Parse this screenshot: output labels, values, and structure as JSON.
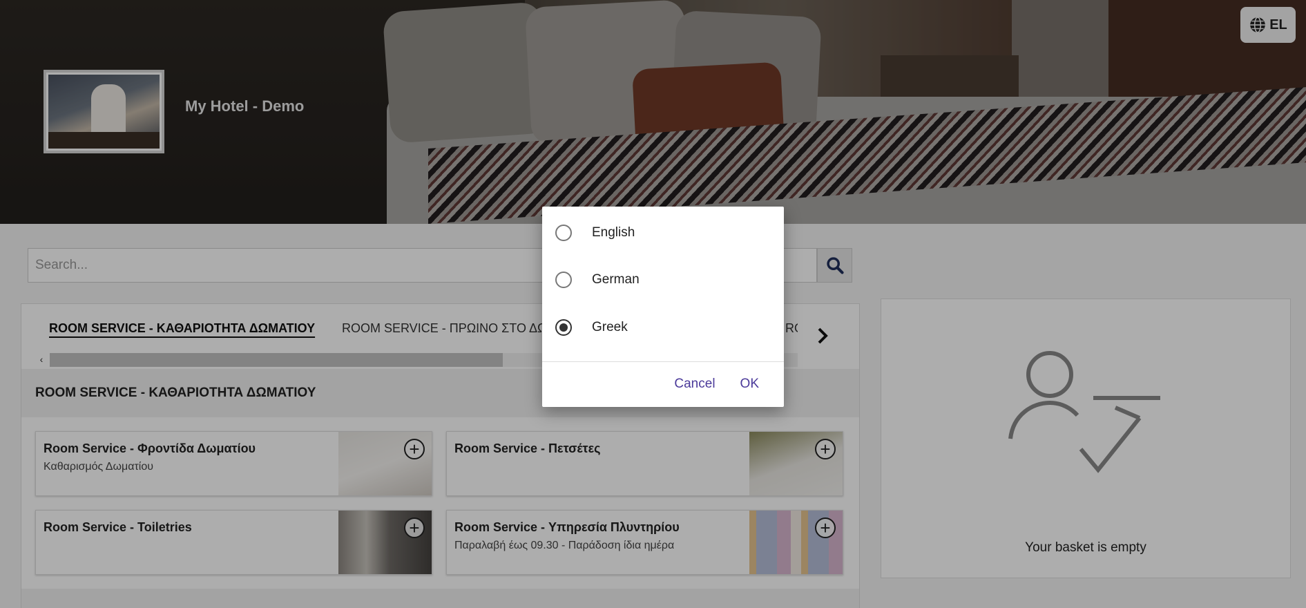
{
  "header": {
    "hotel_name": "My Hotel - Demo",
    "language_button": "EL"
  },
  "search": {
    "placeholder": "Search..."
  },
  "tabs": [
    {
      "label": "ROOM SERVICE - ΚΑΘΑΡΙΟΤΗΤΑ ΔΩΜΑΤΙΟΥ",
      "active": true
    },
    {
      "label": "ROOM SERVICE - ΠΡΩΙΝΟ ΣΤΟ ΔΩΜΑΤΙΟ",
      "active": false
    },
    {
      "label": "ROOM SERVICE - CO",
      "active": false
    }
  ],
  "category": {
    "title": "ROOM SERVICE - ΚΑΘΑΡΙΟΤΗΤΑ ΔΩΜΑΤΙΟΥ",
    "items": [
      {
        "name": "Room Service - Φροντίδα Δωματίου",
        "description": "Καθαρισμός Δωματίου"
      },
      {
        "name": "Room Service - Πετσέτες",
        "description": ""
      },
      {
        "name": "Room Service - Toiletries",
        "description": ""
      },
      {
        "name": "Room Service - Υπηρεσία Πλυντηρίου",
        "description": "Παραλαβή έως 09.30 - Παράδοση ίδια ημέρα"
      }
    ]
  },
  "basket": {
    "empty_text": "Your basket is empty"
  },
  "language_dialog": {
    "options": [
      {
        "label": "English",
        "selected": false
      },
      {
        "label": "German",
        "selected": false
      },
      {
        "label": "Greek",
        "selected": true
      }
    ],
    "cancel_label": "Cancel",
    "ok_label": "OK"
  },
  "colors": {
    "dialog_action": "#4b3a9a",
    "search_icon": "#1f2f5a"
  }
}
